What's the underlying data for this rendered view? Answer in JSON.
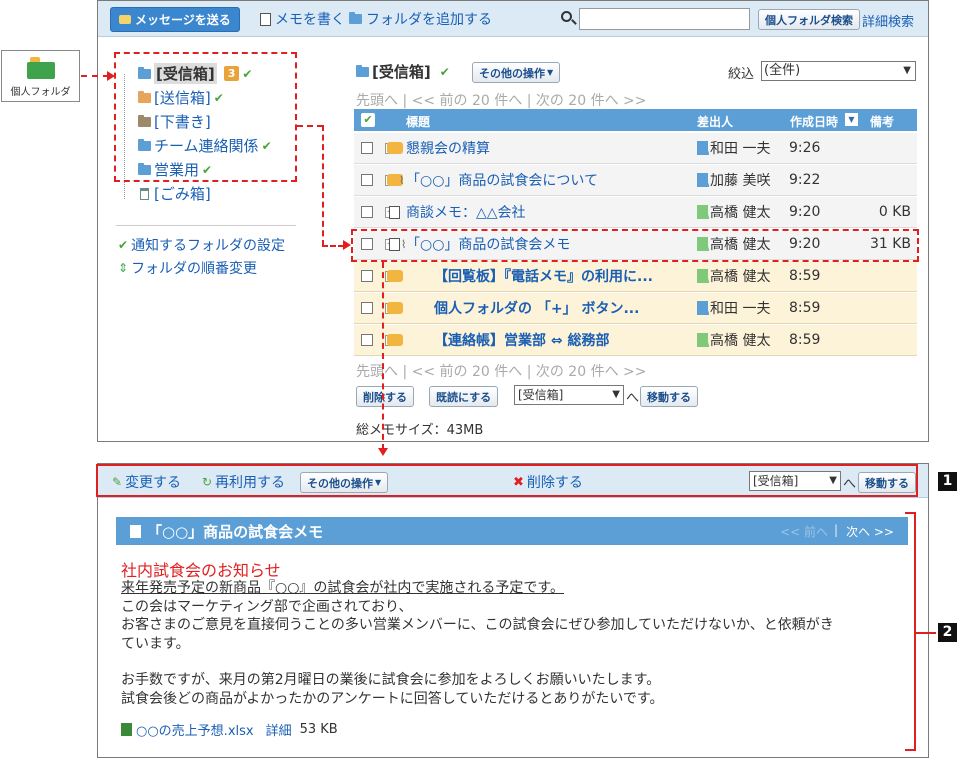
{
  "side_icon": {
    "label": "個人フォルダ"
  },
  "toolbar": {
    "send_label": "メッセージを送る",
    "write_memo": "メモを書く",
    "add_folder": "フォルダを追加する",
    "search_value": "",
    "search_button": "個人フォルダ検索",
    "advanced_search": "詳細検索"
  },
  "folders": [
    {
      "label": "[受信箱]",
      "badge": "3",
      "checked": true,
      "color": "#5b9fd6"
    },
    {
      "label": "[送信箱]",
      "checked": true,
      "color": "#e8a35d"
    },
    {
      "label": "[下書き]",
      "checked": false,
      "color": "#9c8a6b"
    },
    {
      "label": "チーム連絡関係",
      "checked": true,
      "color": "#5b9fd6"
    },
    {
      "label": "営業用",
      "checked": true,
      "color": "#5b9fd6"
    },
    {
      "label": "[ごみ箱]",
      "checked": false,
      "color": "#8aa"
    }
  ],
  "folder_links": {
    "notify_settings": "通知するフォルダの設定",
    "reorder": "フォルダの順番変更"
  },
  "list": {
    "folder_title": "[受信箱]",
    "other_ops": "その他の操作",
    "filter_label": "絞込",
    "filter_value": "(全件)",
    "pager_top": "先頭へ | << 前の 20 件へ | 次の 20 件へ >>",
    "pager_bottom": "先頭へ | << 前の 20 件へ | 次の 20 件へ >>",
    "columns": {
      "subject": "標題",
      "sender": "差出人",
      "datetime": "作成日時",
      "note": "備考"
    },
    "rows": [
      {
        "subject": "懇親会の精算",
        "sender": "和田 一夫",
        "time": "9:26",
        "size": "",
        "type": "message",
        "status": "read",
        "sender_color": "#5b9fd6"
      },
      {
        "subject": "「○○」商品の試食会について",
        "sender": "加藤 美咲",
        "time": "9:22",
        "size": "",
        "type": "message-attach",
        "status": "read",
        "sender_color": "#5b9fd6"
      },
      {
        "subject": "商談メモ：△△会社",
        "sender": "高橋 健太",
        "time": "9:20",
        "size": "0 KB",
        "type": "memo",
        "status": "read",
        "sender_color": "#7fc97a"
      },
      {
        "subject": "「○○」商品の試食会メモ",
        "sender": "高橋 健太",
        "time": "9:20",
        "size": "31 KB",
        "type": "memo-attach",
        "status": "read",
        "sender_color": "#7fc97a"
      },
      {
        "subject": "【回覧板】『電話メモ』の利用に...",
        "sender": "高橋 健太",
        "time": "8:59",
        "size": "",
        "type": "message",
        "status": "unread",
        "sender_color": "#7fc97a"
      },
      {
        "subject": "個人フォルダの 「+」 ボタン...",
        "sender": "和田 一夫",
        "time": "8:59",
        "size": "",
        "type": "message",
        "status": "unread",
        "sender_color": "#5b9fd6"
      },
      {
        "subject": "【連絡帳】営業部 ⇔ 総務部",
        "sender": "高橋 健太",
        "time": "8:59",
        "size": "",
        "type": "message",
        "status": "unread",
        "sender_color": "#7fc97a"
      }
    ],
    "delete_button": "削除する",
    "mark_read_button": "既読にする",
    "move_folder_value": "[受信箱]",
    "move_suffix": "へ",
    "move_button": "移動する",
    "total_size": "総メモサイズ：43MB"
  },
  "detail": {
    "edit": "変更する",
    "reuse": "再利用する",
    "other_ops": "その他の操作",
    "delete": "削除する",
    "move_folder_value": "[受信箱]",
    "move_suffix": "へ",
    "move_button": "移動する",
    "memo_title": "「○○」商品の試食会メモ",
    "prev_link": "<< 前へ",
    "next_link": "次へ >>",
    "heading": "社内試食会のお知らせ",
    "lines": [
      "来年発売予定の新商品『○○』の試食会が社内で実施される予定です。",
      "この会はマーケティング部で企画されており、",
      "お客さまのご意見を直接伺うことの多い営業メンバーに、この試食会にぜひ参加していただけないか、と依頼がき",
      "ています。",
      "",
      "お手数ですが、来月の第2月曜日の業後に試食会に参加をよろしくお願いいたします。",
      "試食会後どの商品がよかったかのアンケートに回答していただけるとありがたいです。"
    ],
    "attachment_name": "○○の売上予想.xlsx",
    "attachment_detail": "詳細",
    "attachment_size": "53 KB"
  },
  "annotations": {
    "label1": "1",
    "label2": "2"
  },
  "colors": {
    "accent": "#3a86cf",
    "annotation": "#e02020",
    "unread_row": "#fdf3d9"
  }
}
